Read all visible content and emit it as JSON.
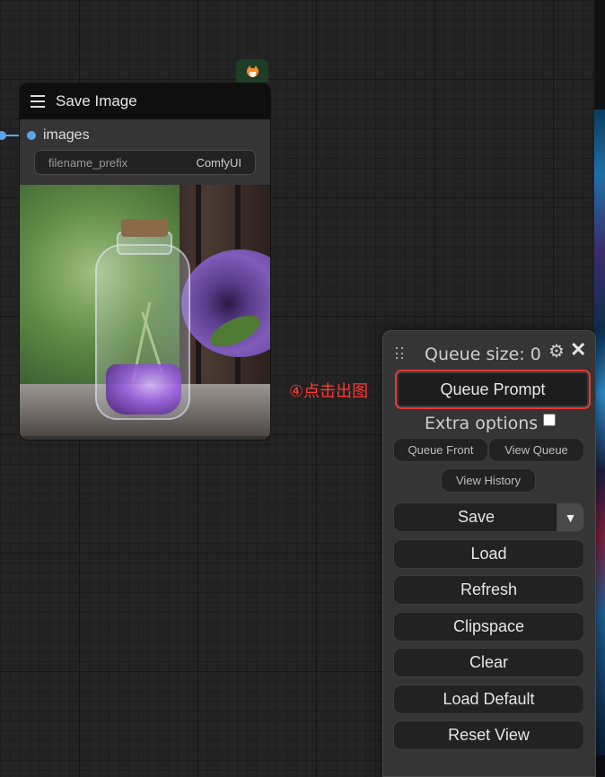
{
  "node": {
    "title": "Save Image",
    "input_label": "images",
    "widget": {
      "name": "filename_prefix",
      "value": "ComfyUI"
    }
  },
  "annotation": "④点击出图",
  "queue_panel": {
    "queue_size": "Queue size: 0",
    "queue_prompt": "Queue Prompt",
    "extra_options": "Extra options",
    "queue_front": "Queue Front",
    "view_queue": "View Queue",
    "view_history": "View History",
    "save": "Save",
    "save_dropdown": "▼",
    "load": "Load",
    "refresh": "Refresh",
    "clipspace": "Clipspace",
    "clear": "Clear",
    "load_default": "Load Default",
    "reset_view": "Reset View",
    "settings_icon": "⚙",
    "close_icon": "✕"
  },
  "colors": {
    "canvas_bg": "#232323",
    "node_bg": "#353535",
    "node_title_bg": "#0f0f0f",
    "slot_blue": "#58a6e8",
    "highlight_red": "#e53935",
    "annotation_red": "#ff3b30"
  },
  "icons": [
    "hamburger-icon",
    "fox-badge-icon",
    "gear-icon",
    "close-icon",
    "drag-handle-icon",
    "chevron-down-icon"
  ]
}
